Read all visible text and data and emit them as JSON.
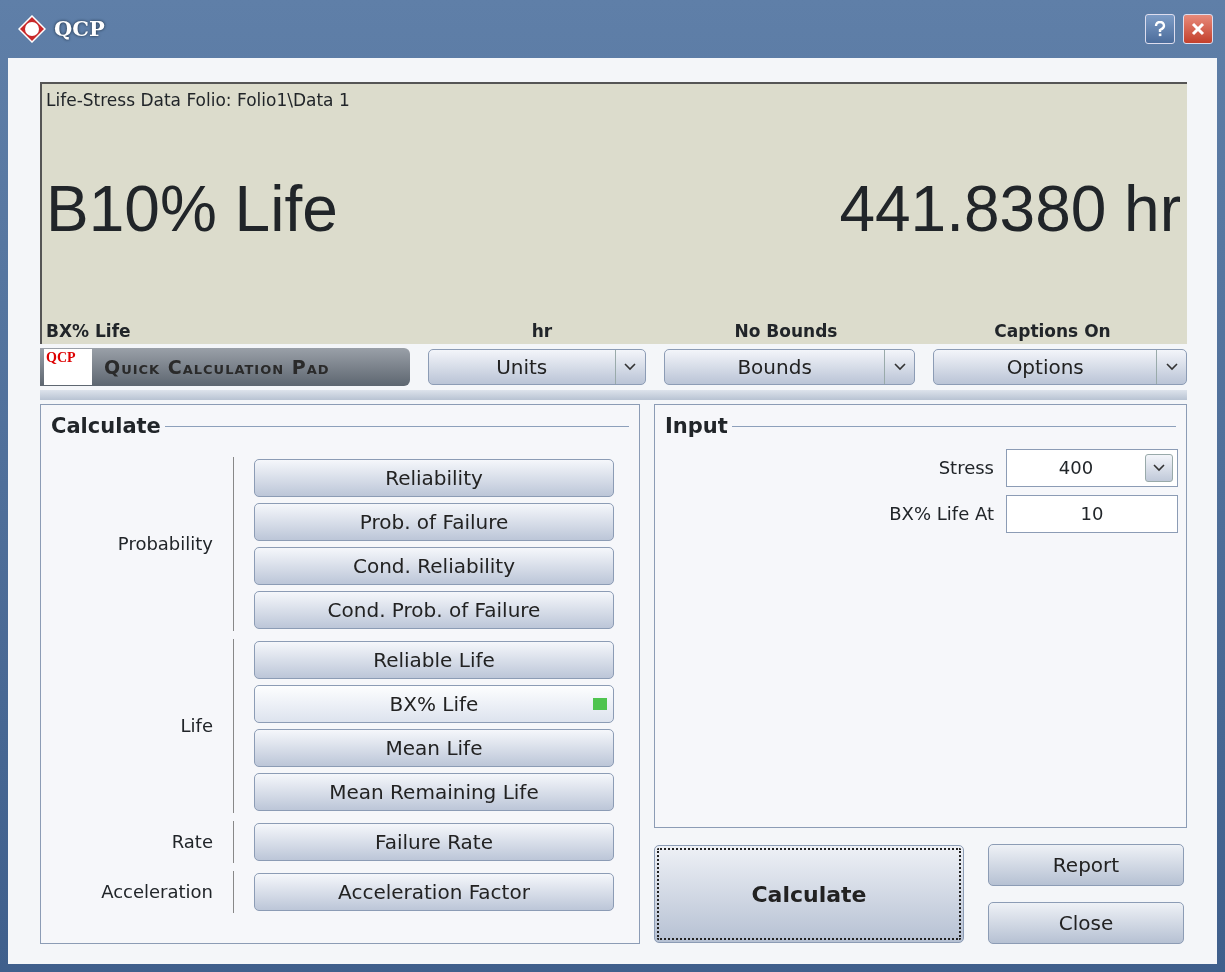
{
  "window": {
    "title": "QCP"
  },
  "display": {
    "source": "Life-Stress Data Folio: Folio1\\Data 1",
    "result_label": "B10% Life",
    "result_value": "441.8380 hr",
    "captions": [
      "BX% Life",
      "hr",
      "No Bounds",
      "Captions On"
    ]
  },
  "toolbar": {
    "logo_text": "QCP",
    "logo_caption": "Quick Calculation Pad",
    "dropdowns": [
      "Units",
      "Bounds",
      "Options"
    ]
  },
  "calculate": {
    "title": "Calculate",
    "groups": [
      {
        "label": "Probability",
        "buttons": [
          {
            "label": "Reliability",
            "selected": false
          },
          {
            "label": "Prob. of Failure",
            "selected": false
          },
          {
            "label": "Cond. Reliability",
            "selected": false
          },
          {
            "label": "Cond. Prob. of Failure",
            "selected": false
          }
        ]
      },
      {
        "label": "Life",
        "buttons": [
          {
            "label": "Reliable Life",
            "selected": false
          },
          {
            "label": "BX% Life",
            "selected": true
          },
          {
            "label": "Mean Life",
            "selected": false
          },
          {
            "label": "Mean Remaining Life",
            "selected": false
          }
        ]
      },
      {
        "label": "Rate",
        "buttons": [
          {
            "label": "Failure Rate",
            "selected": false
          }
        ]
      },
      {
        "label": "Acceleration",
        "buttons": [
          {
            "label": "Acceleration Factor",
            "selected": false
          }
        ]
      }
    ]
  },
  "input": {
    "title": "Input",
    "fields": [
      {
        "label": "Stress",
        "value": "400",
        "kind": "dropdown"
      },
      {
        "label": "BX% Life At",
        "value": "10",
        "kind": "text"
      }
    ]
  },
  "actions": {
    "primary": "Calculate",
    "secondary": [
      "Report",
      "Close"
    ]
  }
}
